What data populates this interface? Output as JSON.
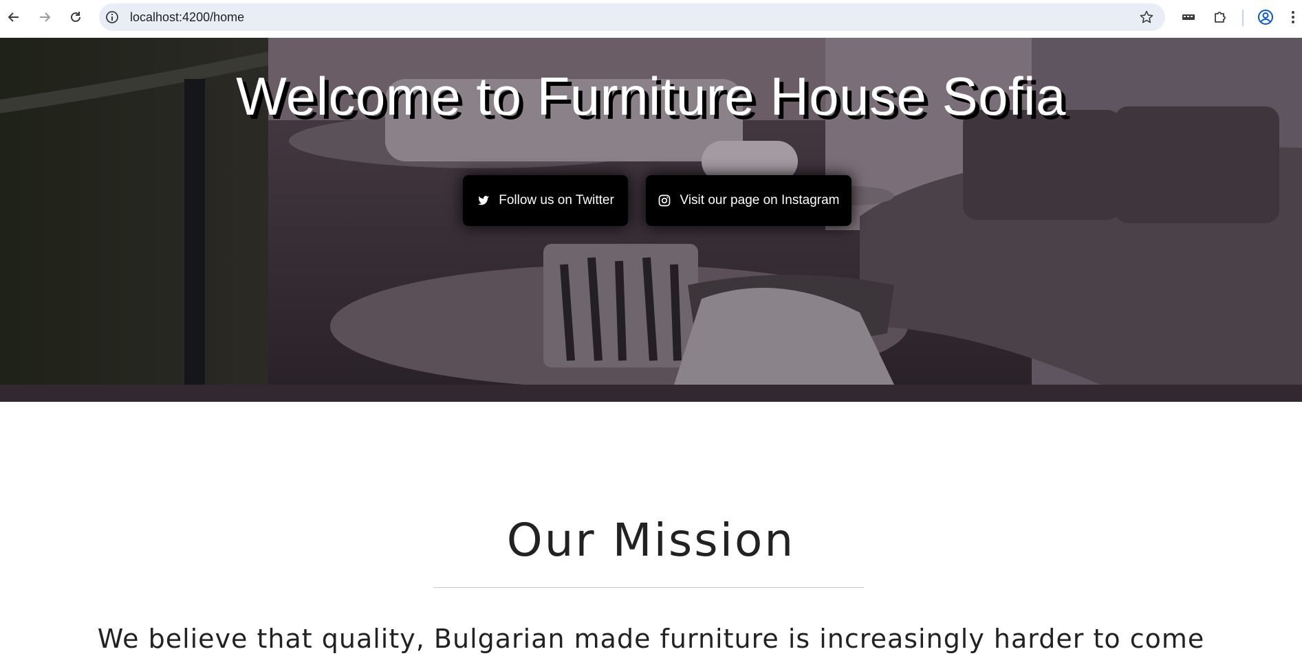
{
  "browser": {
    "url": "localhost:4200/home",
    "icons": [
      "back-icon",
      "forward-icon",
      "reload-icon",
      "site-info-icon",
      "bookmark-star-icon",
      "extension-chip-icon",
      "extensions-puzzle-icon",
      "profile-icon",
      "menu-kebab-icon"
    ]
  },
  "hero": {
    "title": "Welcome to Furniture House Sofia",
    "twitter_label": "Follow us on Twitter",
    "instagram_label": "Visit our page on Instagram"
  },
  "mission": {
    "title": "Our Mission",
    "text": "We believe that quality, Bulgarian made furniture is increasingly harder to come"
  },
  "colors": {
    "hero_overlay": "#2f2630",
    "button_bg": "#000000",
    "text_dark": "#222222",
    "address_bar": "#e9eef6"
  }
}
